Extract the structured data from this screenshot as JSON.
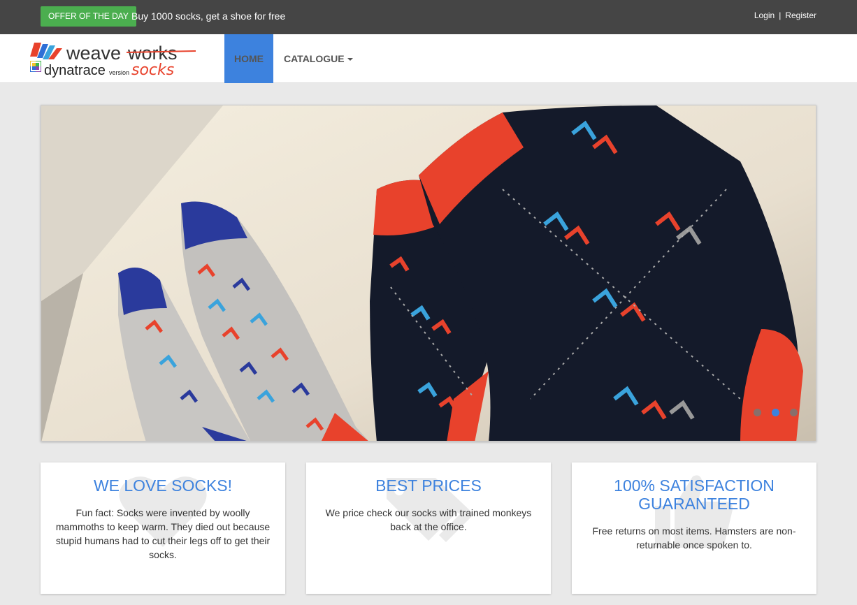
{
  "topbar": {
    "offer_label": "OFFER OF THE DAY",
    "offer_text": "Buy 1000 socks, get a shoe for free",
    "login": "Login",
    "separator": "|",
    "register": "Register"
  },
  "logo": {
    "line1a": "weave",
    "line1b": "works",
    "line2a": "dynatrace",
    "line2b": "version",
    "line2c": "socks"
  },
  "nav": {
    "home": "HOME",
    "catalogue": "CATALOGUE"
  },
  "carousel": {
    "slide_count": 3,
    "active_index": 1
  },
  "features": [
    {
      "title": "WE LOVE SOCKS!",
      "text": "Fun fact: Socks were invented by woolly mammoths to keep warm. They died out because stupid humans had to cut their legs off to get their socks.",
      "icon": "heart-icon"
    },
    {
      "title": "BEST PRICES",
      "text": "We price check our socks with trained monkeys back at the office.",
      "icon": "tags-icon"
    },
    {
      "title": "100% SATISFACTION GUARANTEED",
      "text": "Free returns on most items. Hamsters are non-returnable once spoken to.",
      "icon": "thumbs-up-icon"
    }
  ],
  "colors": {
    "topbar_bg": "#454545",
    "offer_green": "#4bae4f",
    "accent_blue": "#3d82de",
    "logo_red": "#e8422c"
  }
}
